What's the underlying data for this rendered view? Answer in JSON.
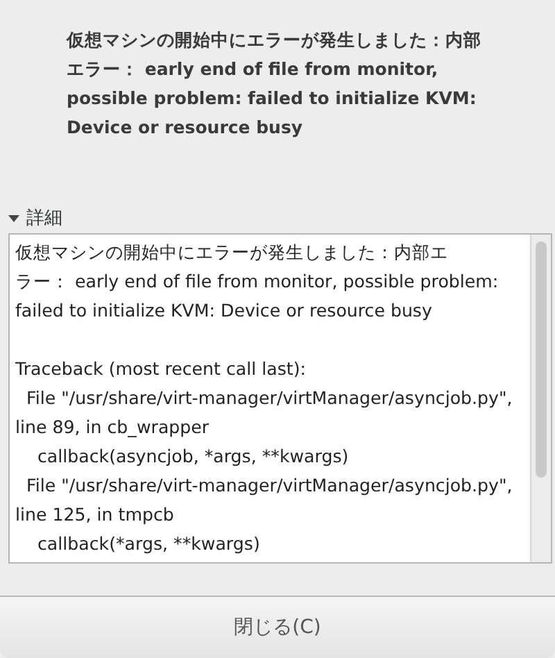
{
  "message": "仮想マシンの開始中にエラーが発生しました：内部エラー： early end of file from monitor, possible problem: failed to initialize KVM: Device or resource busy",
  "details": {
    "label": "詳細",
    "expanded": true,
    "lines": [
      {
        "text": "仮想マシンの開始中にエラーが発生しました：内部エ",
        "gap_before": false
      },
      {
        "text": "ラー： early end of file from monitor, possible problem:",
        "gap_before": false
      },
      {
        "text": "failed to initialize KVM: Device or resource busy",
        "gap_before": false
      },
      {
        "text": "Traceback (most recent call last):",
        "gap_before": true
      },
      {
        "text": "  File \"/usr/share/virt-manager/virtManager/asyncjob.py\",",
        "gap_before": false
      },
      {
        "text": "line 89, in cb_wrapper",
        "gap_before": false
      },
      {
        "text": "    callback(asyncjob, *args, **kwargs)",
        "gap_before": false
      },
      {
        "text": "  File \"/usr/share/virt-manager/virtManager/asyncjob.py\",",
        "gap_before": false
      },
      {
        "text": "line 125, in tmpcb",
        "gap_before": false
      },
      {
        "text": "    callback(*args, **kwargs)",
        "gap_before": false
      }
    ]
  },
  "button": "閉じる(C)"
}
